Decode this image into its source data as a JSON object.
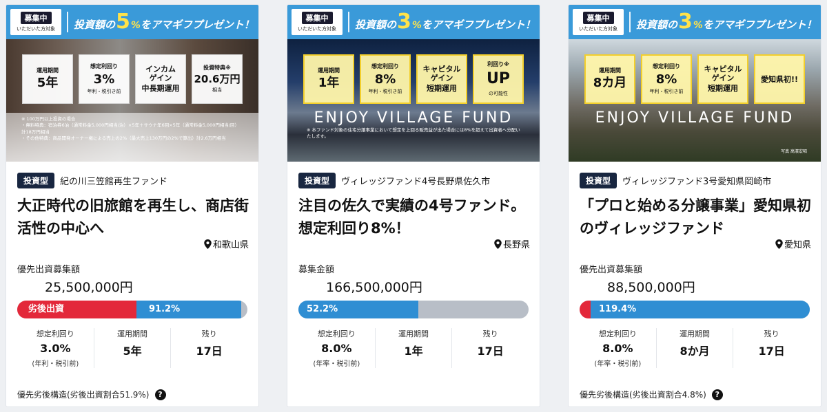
{
  "cards": [
    {
      "banner": {
        "badge": "募集中",
        "badge_sub": "いただいた方対象",
        "promo_prefix": "投資額の",
        "promo_amount": "5",
        "promo_unit": "%",
        "promo_suffix": "をアマギフプレゼント！",
        "features": [
          {
            "label": "運用期間",
            "value": "5年",
            "sub": ""
          },
          {
            "label": "想定利回り",
            "value": "3%",
            "sub": "年利・税引き前"
          },
          {
            "label": "インカム\nゲイン",
            "value": "中長期運用",
            "sub": ""
          },
          {
            "label": "投資特典※",
            "value": "20.6万円",
            "sub": "相当"
          }
        ],
        "note": "※ 100万円以上投資の場合\n・無料特典：宿泊券6泊（通常料金5,000円相当/泊）×5年＋サウナ年6回×5年（通常料金5,000円相当/回）計18万円相当\n・その他特典：商品開発オーナー権による売上の2%（最大売上130万円の2%で算出）計2.6万円相当"
      },
      "type_badge": "投資型",
      "fund_name": "紀の川三笠館再生ファンド",
      "headline": "大正時代の旧旅館を再生し、商店街活性の中心へ",
      "prefecture": "和歌山県",
      "amount_label": "優先出資募集額",
      "amount_value": "25,500,000円",
      "progress": {
        "sub_label": "劣後出資",
        "sub_fraction": 0.519,
        "main_label": "91.2%",
        "main_fraction": 0.456
      },
      "stats": [
        {
          "label": "想定利回り",
          "value": "3.0%",
          "note": "(年利・税引前)"
        },
        {
          "label": "運用期間",
          "value": "5年",
          "note": ""
        },
        {
          "label": "残り",
          "value": "17日",
          "note": ""
        }
      ],
      "structure_text": "優先劣後構造(劣後出資割合51.9%)",
      "help_icon": "?"
    },
    {
      "banner": {
        "badge": "募集中",
        "badge_sub": "いただいた方対象",
        "promo_prefix": "投資額の",
        "promo_amount": "3",
        "promo_unit": "%",
        "promo_suffix": "をアマギフプレゼント！",
        "features": [
          {
            "label": "運用期間",
            "value": "1年",
            "sub": ""
          },
          {
            "label": "想定利回り",
            "value": "8%",
            "sub": "年利・税引き前"
          },
          {
            "label": "キャピタル\nゲイン",
            "value": "短期運用",
            "sub": ""
          },
          {
            "label": "利回り※",
            "value": "UP",
            "sub": "の可能性"
          }
        ],
        "logo": "ENJOY VILLAGE FUND",
        "note": "※ 本ファンド対象の住宅分譲事業において想定を上回る販売益が出た場合には8%を超えて出資者へ分配いたします。"
      },
      "type_badge": "投資型",
      "fund_name": "ヴィレッジファンド4号長野県佐久市",
      "headline": "注目の佐久で実績の4号ファンド。想定利回り8%！",
      "prefecture": "長野県",
      "amount_label": "募集金額",
      "amount_value": "166,500,000円",
      "progress": {
        "sub_label": "",
        "sub_fraction": 0,
        "main_label": "52.2%",
        "main_fraction": 0.522
      },
      "stats": [
        {
          "label": "想定利回り",
          "value": "8.0%",
          "note": "(年率・税引前)"
        },
        {
          "label": "運用期間",
          "value": "1年",
          "note": ""
        },
        {
          "label": "残り",
          "value": "17日",
          "note": ""
        }
      ],
      "structure_text": "",
      "help_icon": ""
    },
    {
      "banner": {
        "badge": "募集中",
        "badge_sub": "いただいた方対象",
        "promo_prefix": "投資額の",
        "promo_amount": "3",
        "promo_unit": "%",
        "promo_suffix": "をアマギフプレゼント！",
        "features": [
          {
            "label": "運用期間",
            "value": "8カ月",
            "sub": ""
          },
          {
            "label": "想定利回り",
            "value": "8%",
            "sub": "年利・税引き前"
          },
          {
            "label": "キャピタル\nゲイン",
            "value": "短期運用",
            "sub": ""
          },
          {
            "label": "",
            "value": "愛知県初!!",
            "sub": ""
          }
        ],
        "logo": "ENJOY VILLAGE FUND",
        "credit": "写真 高濱宏昭"
      },
      "type_badge": "投資型",
      "fund_name": "ヴィレッジファンド3号愛知県岡崎市",
      "headline": "「プロと始める分譲事業」愛知県初のヴィレッジファンド",
      "prefecture": "愛知県",
      "amount_label": "優先出資募集額",
      "amount_value": "88,500,000円",
      "progress": {
        "sub_label": "",
        "sub_fraction": 0.048,
        "main_label": "119.4%",
        "main_fraction": 0.952
      },
      "stats": [
        {
          "label": "想定利回り",
          "value": "8.0%",
          "note": "(年率・税引前)"
        },
        {
          "label": "運用期間",
          "value": "8か月",
          "note": ""
        },
        {
          "label": "残り",
          "value": "17日",
          "note": ""
        }
      ],
      "structure_text": "優先劣後構造(劣後出資割合4.8%)",
      "help_icon": "?"
    }
  ],
  "colors": {
    "banner_blue": "#3a9ad9",
    "subordinate_red": "#e3283a",
    "progress_blue": "#2f8ed3",
    "progress_track": "#b8bec7",
    "badge_navy": "#182640"
  },
  "icons": {
    "location": "map-pin-icon",
    "help": "question-circle-icon"
  }
}
